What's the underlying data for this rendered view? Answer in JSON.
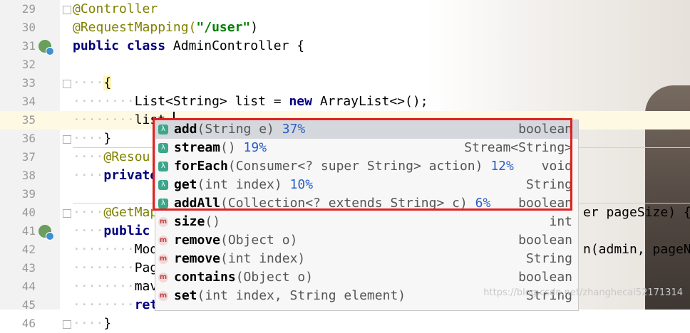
{
  "editor": {
    "lines": [
      {
        "n": "29",
        "parts": [
          {
            "t": "@Controller",
            "c": "ann"
          }
        ]
      },
      {
        "n": "30",
        "parts": [
          {
            "t": "@RequestMapping(",
            "c": "ann"
          },
          {
            "t": "\"/user\"",
            "c": "str"
          },
          {
            "t": ")",
            "c": ""
          }
        ]
      },
      {
        "n": "31",
        "parts": [
          {
            "t": "public class ",
            "c": "kw"
          },
          {
            "t": "AdminController {",
            "c": ""
          }
        ]
      },
      {
        "n": "32",
        "parts": []
      },
      {
        "n": "33",
        "parts": [
          {
            "t": "····",
            "c": "dots"
          },
          {
            "t": "{",
            "c": "brace-hl"
          }
        ]
      },
      {
        "n": "34",
        "parts": [
          {
            "t": "········",
            "c": "dots"
          },
          {
            "t": "List<String> list = ",
            "c": ""
          },
          {
            "t": "new ",
            "c": "kw"
          },
          {
            "t": "ArrayList<>();",
            "c": ""
          }
        ]
      },
      {
        "n": "35",
        "parts": [
          {
            "t": "········",
            "c": "dots"
          },
          {
            "t": "list.",
            "c": ""
          }
        ]
      },
      {
        "n": "36",
        "parts": [
          {
            "t": "····",
            "c": "dots"
          },
          {
            "t": "}",
            "c": ""
          }
        ]
      },
      {
        "n": "37",
        "parts": [
          {
            "t": "····",
            "c": "dots"
          },
          {
            "t": "@Resou",
            "c": "ann"
          }
        ]
      },
      {
        "n": "38",
        "parts": [
          {
            "t": "····",
            "c": "dots"
          },
          {
            "t": "private",
            "c": "kw"
          }
        ]
      },
      {
        "n": "39",
        "parts": []
      },
      {
        "n": "40",
        "parts": [
          {
            "t": "····",
            "c": "dots"
          },
          {
            "t": "@GetMap",
            "c": "ann"
          }
        ]
      },
      {
        "n": "41",
        "parts": [
          {
            "t": "····",
            "c": "dots"
          },
          {
            "t": "public",
            "c": "kw"
          }
        ]
      },
      {
        "n": "42",
        "parts": [
          {
            "t": "········",
            "c": "dots"
          },
          {
            "t": "Mod",
            "c": ""
          }
        ]
      },
      {
        "n": "43",
        "parts": [
          {
            "t": "········",
            "c": "dots"
          },
          {
            "t": "Pag",
            "c": ""
          }
        ]
      },
      {
        "n": "44",
        "parts": [
          {
            "t": "········",
            "c": "dots"
          },
          {
            "t": "mav",
            "c": ""
          }
        ]
      },
      {
        "n": "45",
        "parts": [
          {
            "t": "········",
            "c": "dots"
          },
          {
            "t": "ret",
            "c": "kw"
          }
        ]
      },
      {
        "n": "46",
        "parts": [
          {
            "t": "····",
            "c": "dots"
          },
          {
            "t": "}",
            "c": ""
          }
        ]
      }
    ],
    "right_fragments": {
      "line41": "er pageSize) {",
      "line43": "n(admin, pageNu"
    }
  },
  "completion": {
    "items": [
      {
        "icon": "lambda",
        "name": "add",
        "params": "(String e)",
        "pct": "37%",
        "type": "boolean",
        "selected": true
      },
      {
        "icon": "lambda",
        "name": "stream",
        "params": "()",
        "pct": "19%",
        "type": "Stream<String>"
      },
      {
        "icon": "lambda",
        "name": "forEach",
        "params": "(Consumer<? super String> action)",
        "pct": "12%",
        "type": "void"
      },
      {
        "icon": "lambda",
        "name": "get",
        "params": "(int index)",
        "pct": "10%",
        "type": "String"
      },
      {
        "icon": "lambda",
        "name": "addAll",
        "params": "(Collection<? extends String> c)",
        "pct": "6%",
        "type": "boolean"
      },
      {
        "icon": "method",
        "name": "size",
        "params": "()",
        "pct": "",
        "type": "int"
      },
      {
        "icon": "method",
        "name": "remove",
        "params": "(Object o)",
        "pct": "",
        "type": "boolean"
      },
      {
        "icon": "method",
        "name": "remove",
        "params": "(int index)",
        "pct": "",
        "type": "String"
      },
      {
        "icon": "method",
        "name": "contains",
        "params": "(Object o)",
        "pct": "",
        "type": "boolean"
      },
      {
        "icon": "method",
        "name": "set",
        "params": "(int index, String element)",
        "pct": "",
        "type": "String"
      }
    ],
    "icon_glyphs": {
      "lambda": "λ",
      "method": "m"
    }
  },
  "watermark": "https://blog.csdn.net/zhanghecai52171314",
  "colors": {
    "annotation": "#808000",
    "keyword": "#000080",
    "string": "#008000",
    "selection_box": "#e02020"
  }
}
